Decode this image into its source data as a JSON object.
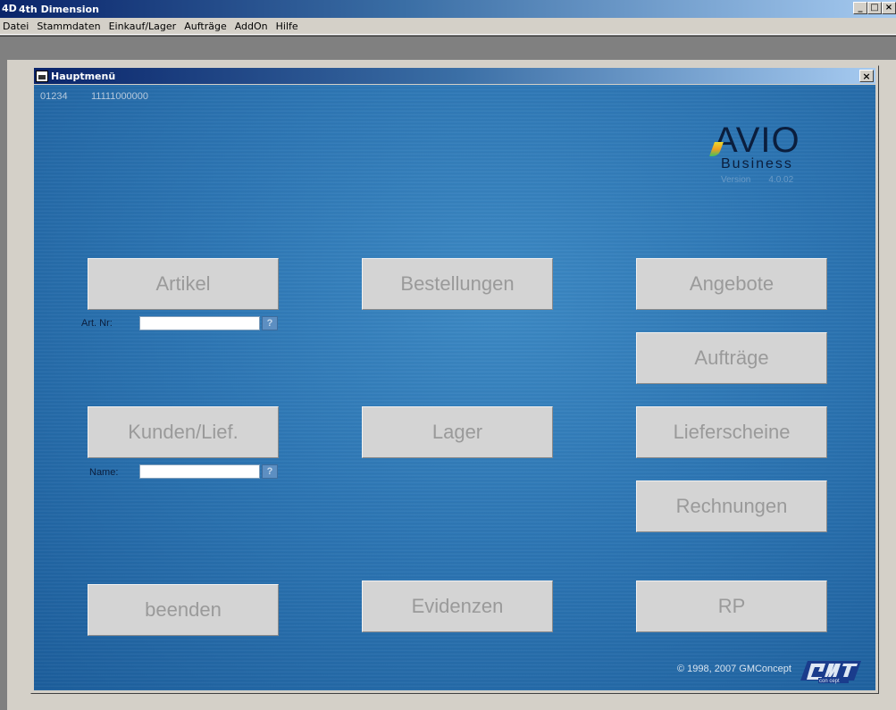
{
  "app": {
    "logo": "4D",
    "title": "4th Dimension",
    "minimize": "_",
    "maximize": "□",
    "close": "×"
  },
  "menu": [
    "Datei",
    "Stammdaten",
    "Einkauf/Lager",
    "Aufträge",
    "AddOn",
    "Hilfe"
  ],
  "window": {
    "title": "Hauptmenü",
    "close": "×"
  },
  "header": {
    "code": "01234",
    "number": "11111000000"
  },
  "logo": {
    "brand": "AVIO",
    "sub": "Business",
    "version_label": "Version",
    "version": "4.0.02"
  },
  "buttons": {
    "artikel": "Artikel",
    "bestellungen": "Bestellungen",
    "angebote": "Angebote",
    "auftraege": "Aufträge",
    "kunden": "Kunden/Lief.",
    "lager": "Lager",
    "lieferscheine": "Lieferscheine",
    "rechnungen": "Rechnungen",
    "beenden": "beenden",
    "evidenzen": "Evidenzen",
    "rp": "RP"
  },
  "fields": {
    "art_nr_label": "Art. Nr:",
    "art_nr_value": "",
    "name_label": "Name:",
    "name_value": "",
    "help": "?"
  },
  "footer": {
    "copyright": "© 1998, 2007 GMConcept",
    "company_logo": "GM concept"
  },
  "colors": {
    "background": "#2d76b4",
    "button": "#d4d4d4",
    "button_text": "#9a9a9a",
    "titlebar": "#0a246a"
  }
}
